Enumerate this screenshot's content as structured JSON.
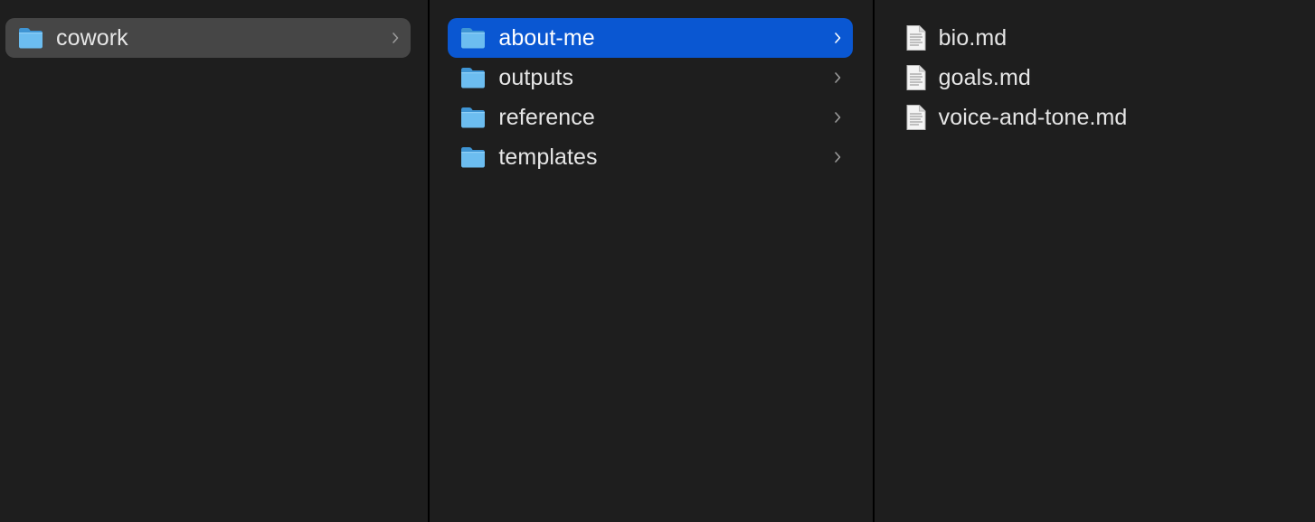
{
  "columns": [
    {
      "items": [
        {
          "name": "cowork",
          "kind": "folder",
          "icon": "folder-icon",
          "state": "path-selected",
          "has_children": true
        }
      ]
    },
    {
      "items": [
        {
          "name": "about-me",
          "kind": "folder",
          "icon": "folder-icon",
          "state": "selected",
          "has_children": true
        },
        {
          "name": "outputs",
          "kind": "folder",
          "icon": "folder-icon",
          "state": "none",
          "has_children": true
        },
        {
          "name": "reference",
          "kind": "folder",
          "icon": "folder-icon",
          "state": "none",
          "has_children": true
        },
        {
          "name": "templates",
          "kind": "folder",
          "icon": "folder-icon",
          "state": "none",
          "has_children": true
        }
      ]
    },
    {
      "items": [
        {
          "name": "bio.md",
          "kind": "file",
          "icon": "document-icon",
          "state": "none",
          "has_children": false
        },
        {
          "name": "goals.md",
          "kind": "file",
          "icon": "document-icon",
          "state": "none",
          "has_children": false
        },
        {
          "name": "voice-and-tone.md",
          "kind": "file",
          "icon": "document-icon",
          "state": "none",
          "has_children": false
        }
      ]
    }
  ],
  "colors": {
    "background": "#1e1e1e",
    "divider": "#000000",
    "selection": "#0a57d2",
    "path_selection": "#464646",
    "folder": "#5fb2ea",
    "text": "#e6e6e6"
  }
}
